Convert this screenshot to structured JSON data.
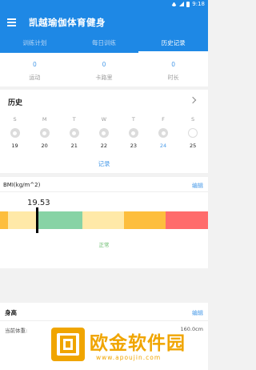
{
  "status_bar": {
    "time": "9:18",
    "icons": [
      "wifi-icon",
      "signal-icon",
      "battery-icon"
    ]
  },
  "app_bar": {
    "title": "凯越瑜伽体育健身",
    "menu_icon": "menu-icon"
  },
  "tabs": [
    {
      "label": "训练计划",
      "active": false
    },
    {
      "label": "每日训练",
      "active": false
    },
    {
      "label": "历史记录",
      "active": true
    }
  ],
  "stats": [
    {
      "value": "0",
      "label": "运动"
    },
    {
      "value": "0",
      "label": "卡路里"
    },
    {
      "value": "0",
      "label": "时长"
    }
  ],
  "history": {
    "title": "历史",
    "chevron_icon": "chevron-right-icon",
    "days": [
      {
        "weekday": "S",
        "date": "19",
        "today": false
      },
      {
        "weekday": "M",
        "date": "20",
        "today": false
      },
      {
        "weekday": "T",
        "date": "21",
        "today": false
      },
      {
        "weekday": "W",
        "date": "22",
        "today": false
      },
      {
        "weekday": "T",
        "date": "23",
        "today": false
      },
      {
        "weekday": "F",
        "date": "24",
        "today": true
      },
      {
        "weekday": "S",
        "date": "25",
        "today": false
      }
    ],
    "record_link": "记录"
  },
  "bmi": {
    "label": "BMI(kg/m^2)",
    "edit_label": "编辑",
    "value": "19.53",
    "status": "正常",
    "scale_colors": [
      "#fdbe3d",
      "#ffe9a8",
      "#87d3a5",
      "#ffe9a8",
      "#fdbe3d",
      "#ff6b6b"
    ]
  },
  "body": {
    "title": "身高",
    "edit_label": "编辑",
    "rows": [
      {
        "label": "当前体重:",
        "value": "160.0cm"
      }
    ]
  },
  "watermark": {
    "name": "欧金软件园",
    "url": "www.apoujin.com",
    "color": "#f0a500"
  }
}
